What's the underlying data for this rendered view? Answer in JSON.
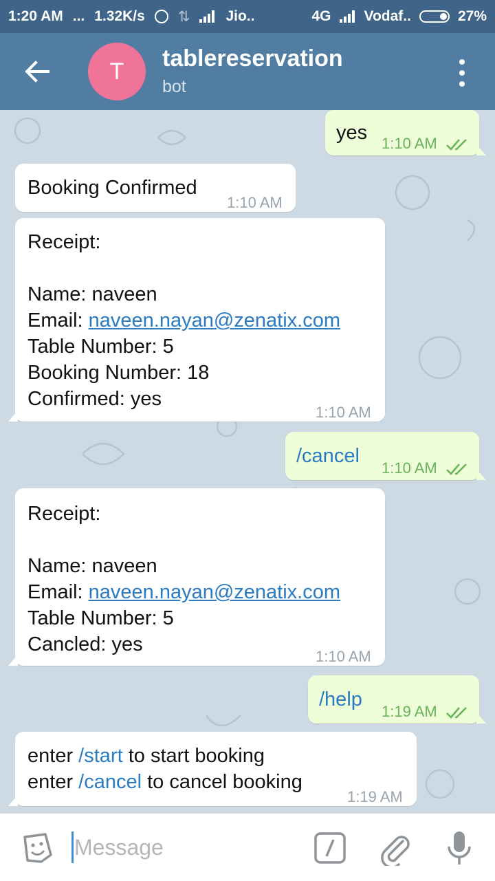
{
  "status_bar": {
    "time": "1:20 AM",
    "dots": "...",
    "speed": "1.32K/s",
    "carrier1": "Jio..",
    "network": "4G",
    "carrier2": "Vodaf..",
    "battery": "27%"
  },
  "header": {
    "avatar_letter": "T",
    "title": "tablereservation",
    "subtitle": "bot",
    "avatar_color": "#f0739a",
    "bar_color": "#527da3"
  },
  "messages": [
    {
      "direction": "out",
      "text": "yes",
      "time": "1:10 AM",
      "read": true
    },
    {
      "direction": "in",
      "text": "Booking Confirmed",
      "time": "1:10 AM"
    },
    {
      "direction": "in",
      "lines": {
        "l1": "Receipt:",
        "l2": "",
        "l3": "Name: naveen",
        "l4_prefix": "Email: ",
        "l4_link": "naveen.nayan@zenatix.com",
        "l5": "Table Number: 5",
        "l6": "Booking Number: 18",
        "l7": "Confirmed: yes"
      },
      "time": "1:10 AM"
    },
    {
      "direction": "out",
      "text": "/cancel",
      "time": "1:10 AM",
      "read": true
    },
    {
      "direction": "in",
      "lines": {
        "l1": "Receipt:",
        "l2": "",
        "l3": "Name: naveen",
        "l4_prefix": "Email: ",
        "l4_link": "naveen.nayan@zenatix.com",
        "l5": "Table Number: 5",
        "l6": "Cancled: yes"
      },
      "time": "1:10 AM"
    },
    {
      "direction": "out",
      "text": "/help",
      "time": "1:19 AM",
      "read": true
    },
    {
      "direction": "in",
      "help": {
        "a_pre": "enter ",
        "a_cmd": "/start",
        "a_post": " to start booking",
        "b_pre": "enter ",
        "b_cmd": "/cancel",
        "b_post": " to cancel booking"
      },
      "time": "1:19 AM"
    }
  ],
  "input": {
    "placeholder": "Message"
  },
  "colors": {
    "outgoing_bubble": "#eefed9",
    "incoming_bubble": "#ffffff",
    "link": "#2a7bc2",
    "read_ticks": "#6bb35a"
  },
  "icons": [
    "back-arrow-icon",
    "more-vert-icon",
    "sticker-icon",
    "bot-command-icon",
    "paperclip-icon",
    "microphone-icon",
    "double-check-icon"
  ]
}
